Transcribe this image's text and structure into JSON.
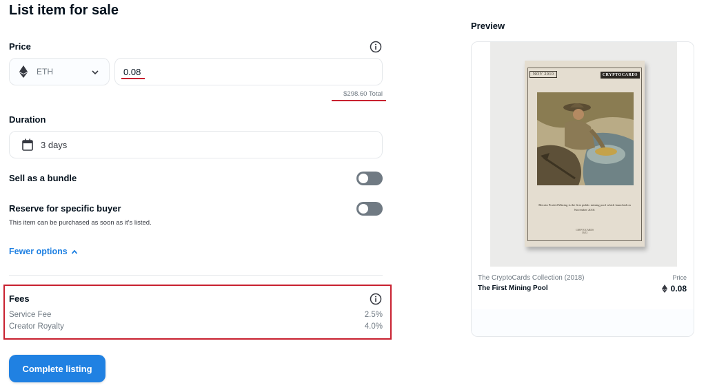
{
  "header": {
    "title": "List item for sale"
  },
  "price": {
    "label": "Price",
    "currency": "ETH",
    "value": "0.08",
    "total": "$298.60 Total"
  },
  "duration": {
    "label": "Duration",
    "value": "3 days"
  },
  "bundle": {
    "label": "Sell as a bundle",
    "enabled": false
  },
  "reserve": {
    "label": "Reserve for specific buyer",
    "sublabel": "This item can be purchased as soon as it's listed.",
    "enabled": false
  },
  "options": {
    "fewer_label": "Fewer options"
  },
  "fees": {
    "title": "Fees",
    "rows": [
      {
        "label": "Service Fee",
        "value": "2.5%"
      },
      {
        "label": "Creator Royalty",
        "value": "4.0%"
      }
    ]
  },
  "actions": {
    "complete_label": "Complete listing"
  },
  "preview": {
    "title": "Preview",
    "collection": "The CryptoCards Collection (2018)",
    "item_name": "The First Mining Pool",
    "price_label": "Price",
    "price_value": "0.08",
    "card": {
      "date": "NOV 2010",
      "brand": "CRYPTOCARDS",
      "caption": "Bitcoin Pooled Mining is the first public mining pool which launched on November 2010.",
      "footer": "CRYPTOCARDS",
      "number": "16/33"
    }
  },
  "colors": {
    "accent": "#2081e2",
    "highlight_red": "#c8202f",
    "toggle_off": "#707a83",
    "muted_text": "#707a83",
    "border": "#e5e8eb"
  },
  "icons": [
    "eth-icon",
    "chevron-down-icon",
    "info-icon",
    "calendar-icon",
    "chevron-up-icon"
  ]
}
